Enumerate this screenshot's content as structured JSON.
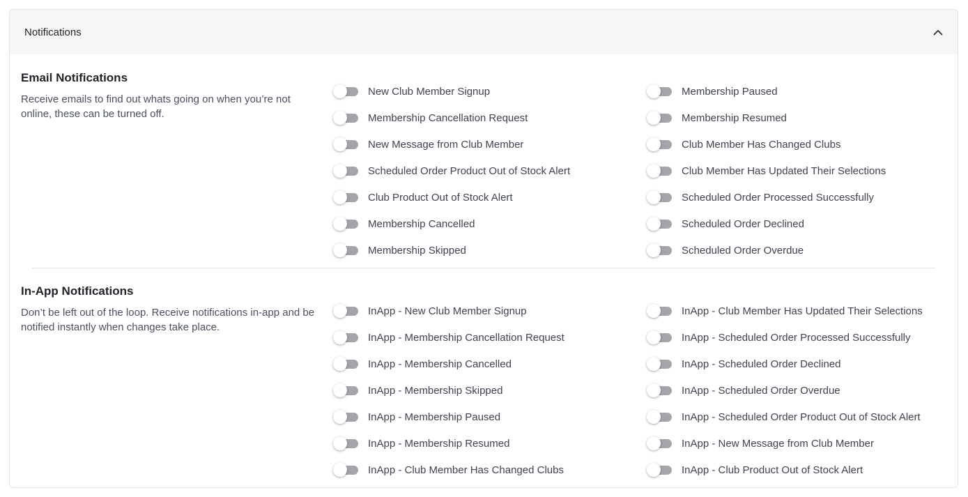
{
  "panel": {
    "title": "Notifications",
    "collapse_icon": "chevron-up-icon"
  },
  "email": {
    "title": "Email Notifications",
    "description": "Receive emails to find out whats going on when you’re not online, these can be turned off.",
    "left": [
      {
        "label": "New Club Member Signup",
        "on": false
      },
      {
        "label": "Membership Cancellation Request",
        "on": false
      },
      {
        "label": "New Message from Club Member",
        "on": false
      },
      {
        "label": "Scheduled Order Product Out of Stock Alert",
        "on": false
      },
      {
        "label": "Club Product Out of Stock Alert",
        "on": false
      },
      {
        "label": "Membership Cancelled",
        "on": false
      },
      {
        "label": "Membership Skipped",
        "on": false
      }
    ],
    "right": [
      {
        "label": "Membership Paused",
        "on": false
      },
      {
        "label": "Membership Resumed",
        "on": false
      },
      {
        "label": "Club Member Has Changed Clubs",
        "on": false
      },
      {
        "label": "Club Member Has Updated Their Selections",
        "on": false
      },
      {
        "label": "Scheduled Order Processed Successfully",
        "on": false
      },
      {
        "label": "Scheduled Order Declined",
        "on": false
      },
      {
        "label": "Scheduled Order Overdue",
        "on": false
      }
    ]
  },
  "inapp": {
    "title": "In-App Notifications",
    "description": "Don’t be left out of the loop. Receive notifications in-app and be notified instantly when changes take place.",
    "left": [
      {
        "label": "InApp - New Club Member Signup",
        "on": false
      },
      {
        "label": "InApp - Membership Cancellation Request",
        "on": false
      },
      {
        "label": "InApp - Membership Cancelled",
        "on": false
      },
      {
        "label": "InApp - Membership Skipped",
        "on": false
      },
      {
        "label": "InApp - Membership Paused",
        "on": false
      },
      {
        "label": "InApp - Membership Resumed",
        "on": false
      },
      {
        "label": "InApp - Club Member Has Changed Clubs",
        "on": false
      }
    ],
    "right": [
      {
        "label": "InApp - Club Member Has Updated Their Selections",
        "on": false
      },
      {
        "label": "InApp - Scheduled Order Processed Successfully",
        "on": false
      },
      {
        "label": "InApp - Scheduled Order Declined",
        "on": false
      },
      {
        "label": "InApp - Scheduled Order Overdue",
        "on": false
      },
      {
        "label": "InApp - Scheduled Order Product Out of Stock Alert",
        "on": false
      },
      {
        "label": "InApp - New Message from Club Member",
        "on": false
      },
      {
        "label": "InApp - Club Product Out of Stock Alert",
        "on": false
      }
    ]
  },
  "colors": {
    "track_off": "#a3a5ab",
    "header_bg": "#f6f6f7",
    "border": "#e3e4e7"
  }
}
